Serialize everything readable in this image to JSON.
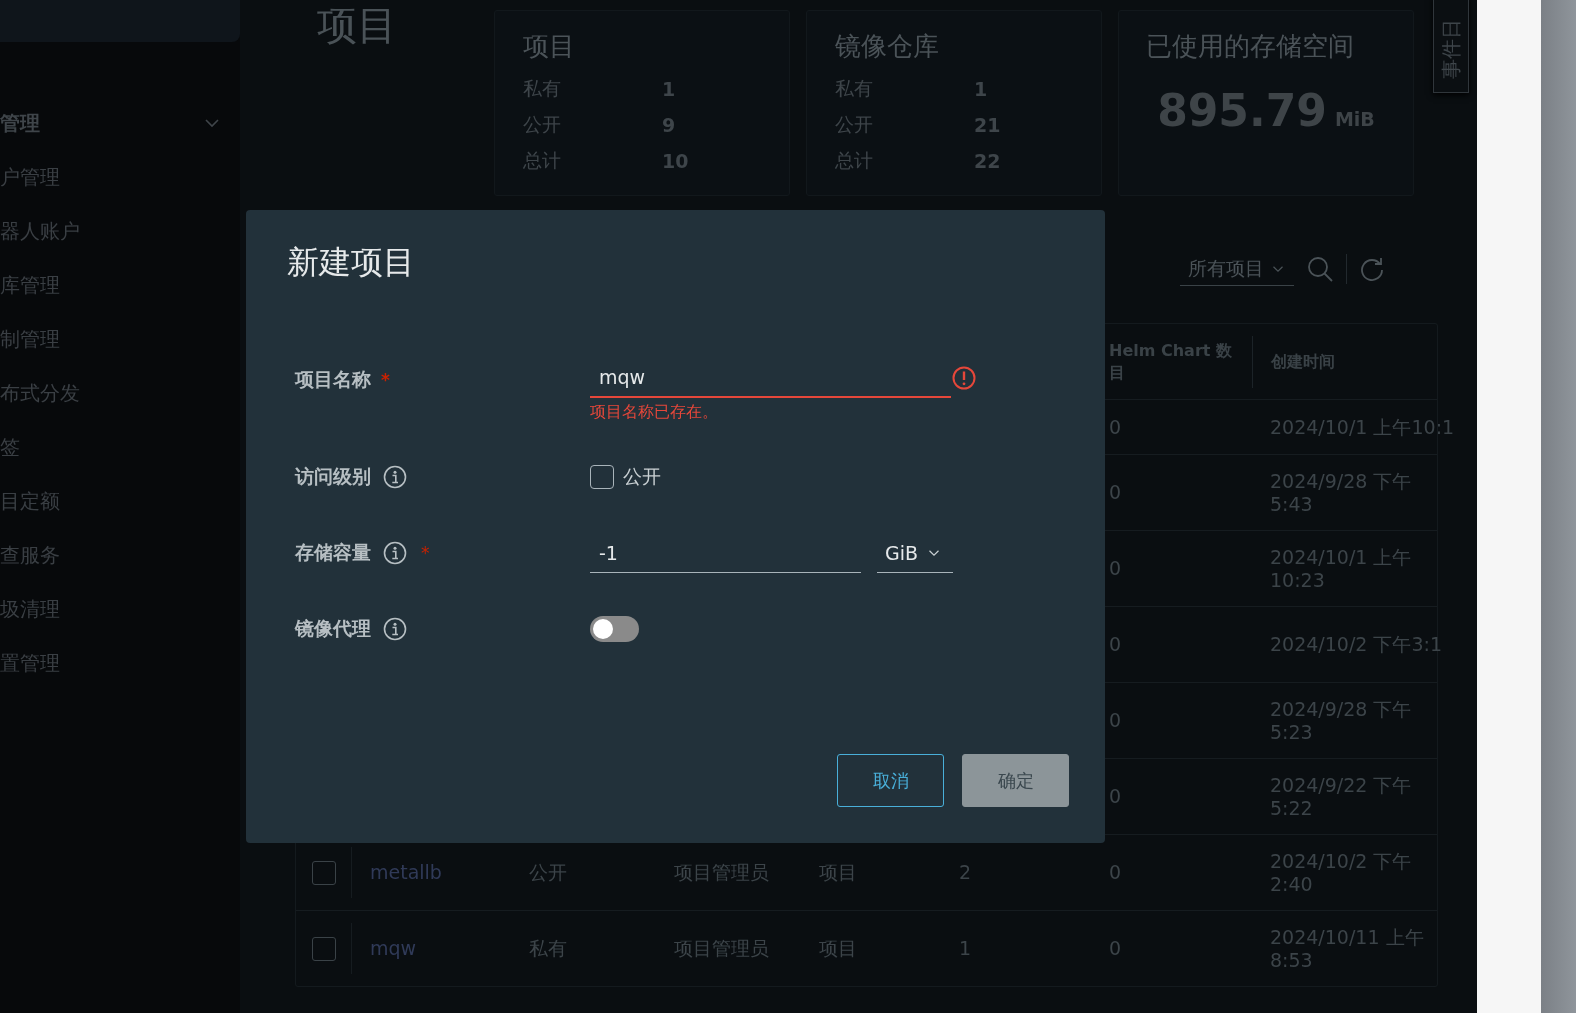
{
  "sidebar": {
    "items": [
      {
        "label": "管理",
        "expanded": true,
        "children": [
          {
            "label": "户管理"
          },
          {
            "label": "器人账户"
          },
          {
            "label": "库管理"
          },
          {
            "label": "制管理"
          },
          {
            "label": "布式分发"
          },
          {
            "label": "签"
          },
          {
            "label": "目定额"
          },
          {
            "label": "查服务"
          },
          {
            "label": "圾清理"
          },
          {
            "label": "置管理"
          }
        ]
      }
    ]
  },
  "page_title": "项目",
  "summary_cards": [
    {
      "kind": "counts",
      "title": "项目",
      "rows": [
        {
          "label": "私有",
          "value": "1"
        },
        {
          "label": "公开",
          "value": "9"
        },
        {
          "label": "总计",
          "value": "10"
        }
      ]
    },
    {
      "kind": "counts",
      "title": "镜像仓库",
      "rows": [
        {
          "label": "私有",
          "value": "1"
        },
        {
          "label": "公开",
          "value": "21"
        },
        {
          "label": "总计",
          "value": "22"
        }
      ]
    },
    {
      "kind": "storage",
      "title": "已使用的存储空间",
      "value": "895.79",
      "unit": "MiB"
    }
  ],
  "event_log_tab": {
    "label": "事件日"
  },
  "toolbar": {
    "filter": "所有项目"
  },
  "table": {
    "columns": [
      {
        "label": "Helm Chart 数目"
      },
      {
        "label": "创建时间"
      }
    ],
    "rows": [
      {
        "kind": "single",
        "helm": "0",
        "created": "2024/10/1 上午10:1"
      },
      {
        "kind": "double",
        "helm": "0",
        "created": "2024/9/28 下午5:43"
      },
      {
        "kind": "double",
        "helm": "0",
        "created": "2024/10/1 上午10:23"
      },
      {
        "kind": "single",
        "helm": "0",
        "created": "2024/10/2 下午3:1"
      },
      {
        "kind": "double",
        "helm": "0",
        "created": "2024/9/28 下午5:23"
      },
      {
        "kind": "double",
        "helm": "0",
        "created": "2024/9/22 下午5:22"
      },
      {
        "kind": "double",
        "checked": false,
        "name": "metallb",
        "access": "公开",
        "role": "项目管理员",
        "type": "项目",
        "repos": "2",
        "helm": "0",
        "created": "2024/10/2 下午2:40"
      },
      {
        "kind": "double",
        "checked": false,
        "name": "mqw",
        "access": "私有",
        "role": "项目管理员",
        "type": "项目",
        "repos": "1",
        "helm": "0",
        "created": "2024/10/11 上午8:53"
      }
    ]
  },
  "dialog": {
    "title": "新建项目",
    "fields": [
      {
        "kind": "text",
        "label": "项目名称",
        "required_mark": "*",
        "value": "mqw",
        "error": "项目名称已存在。"
      },
      {
        "kind": "checkbox",
        "label": "访问级别",
        "info": true,
        "option": "公开",
        "checked": false
      },
      {
        "kind": "quota",
        "label": "存储容量",
        "info": true,
        "required_mark": "*",
        "value": "-1",
        "unit": "GiB"
      },
      {
        "kind": "toggle",
        "label": "镜像代理",
        "info": true,
        "on": false
      }
    ],
    "buttons": [
      {
        "label": "取消",
        "kind": "outline",
        "disabled": false
      },
      {
        "label": "确定",
        "kind": "primary",
        "disabled": true
      }
    ]
  }
}
